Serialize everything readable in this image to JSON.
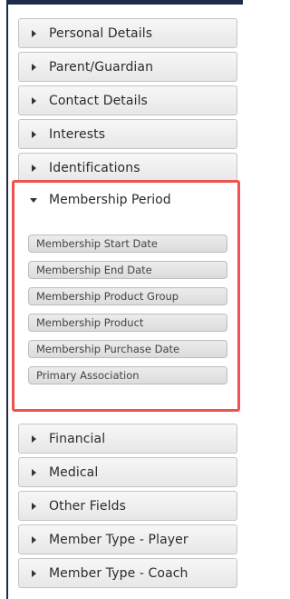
{
  "panels_before": [
    {
      "label": "Personal Details"
    },
    {
      "label": "Parent/Guardian"
    },
    {
      "label": "Contact Details"
    },
    {
      "label": "Interests"
    },
    {
      "label": "Identifications"
    }
  ],
  "expanded_panel": {
    "label": "Membership Period",
    "fields": [
      {
        "label": "Membership Start Date"
      },
      {
        "label": "Membership End Date"
      },
      {
        "label": "Membership Product Group"
      },
      {
        "label": "Membership Product"
      },
      {
        "label": "Membership Purchase Date"
      },
      {
        "label": "Primary Association"
      }
    ],
    "highlight_color": "#f0524e"
  },
  "panels_after": [
    {
      "label": "Financial"
    },
    {
      "label": "Medical"
    },
    {
      "label": "Other Fields"
    },
    {
      "label": "Member Type - Player"
    },
    {
      "label": "Member Type - Coach"
    }
  ],
  "icons": {
    "collapsed": "caret-right-icon",
    "expanded": "caret-down-icon"
  }
}
